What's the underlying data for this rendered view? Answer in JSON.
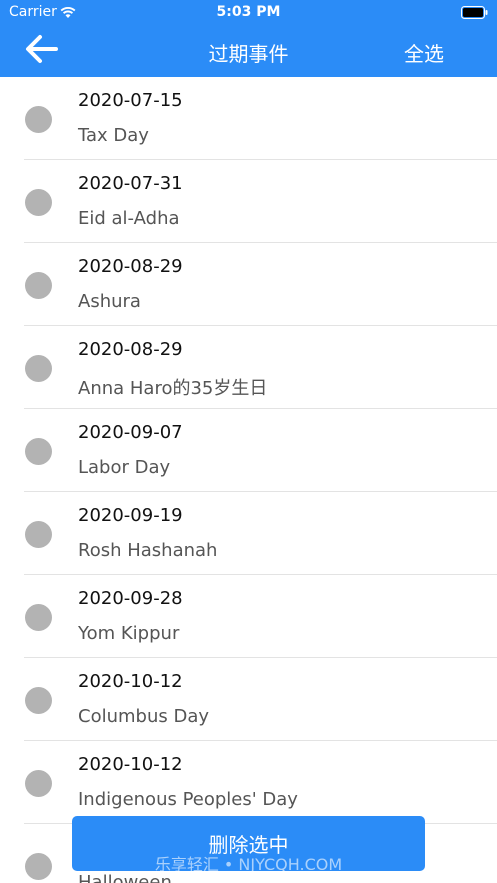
{
  "status_bar": {
    "carrier": "Carrier",
    "time": "5:03 PM"
  },
  "nav": {
    "title": "过期事件",
    "select_all": "全选"
  },
  "events": [
    {
      "date": "2020-07-15",
      "name": "Tax Day"
    },
    {
      "date": "2020-07-31",
      "name": "Eid al-Adha"
    },
    {
      "date": "2020-08-29",
      "name": "Ashura"
    },
    {
      "date": "2020-08-29",
      "name": "Anna Haro的35岁生日"
    },
    {
      "date": "2020-09-07",
      "name": "Labor Day"
    },
    {
      "date": "2020-09-19",
      "name": "Rosh Hashanah"
    },
    {
      "date": "2020-09-28",
      "name": "Yom Kippur"
    },
    {
      "date": "2020-10-12",
      "name": "Columbus Day"
    },
    {
      "date": "2020-10-12",
      "name": "Indigenous Peoples' Day"
    },
    {
      "date": "",
      "name": "Halloween"
    }
  ],
  "delete_button": "删除选中",
  "watermark": "乐享轻汇 • NJYCQH.COM",
  "colors": {
    "accent": "#2b8cf7",
    "radio_unchecked": "#b3b3b3",
    "divider": "#e3e3e3"
  }
}
